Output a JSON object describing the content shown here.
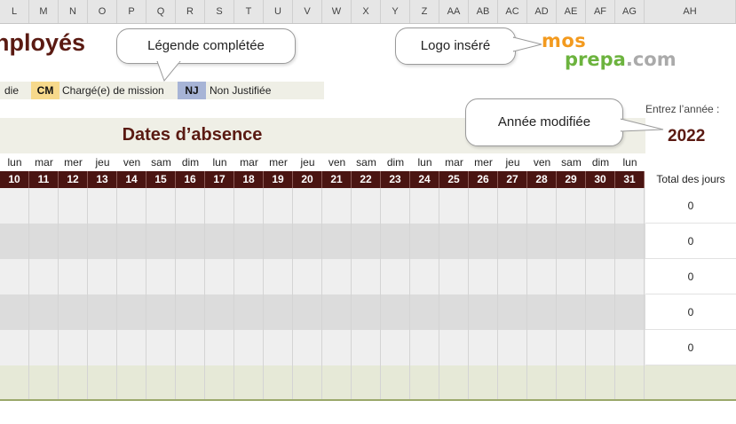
{
  "column_headers": [
    "L",
    "M",
    "N",
    "O",
    "P",
    "Q",
    "R",
    "S",
    "T",
    "U",
    "V",
    "W",
    "X",
    "Y",
    "Z",
    "AA",
    "AB",
    "AC",
    "AD",
    "AE",
    "AF",
    "AG",
    "AH"
  ],
  "title": "nployés",
  "legend": {
    "item1_text": "die",
    "cm_code": "CM",
    "cm_text": "Chargé(e) de mission",
    "nj_code": "NJ",
    "nj_text": "Non Justifiée",
    "cm_color": "#f7d98b",
    "nj_color": "#a7b4d6"
  },
  "callouts": {
    "legend": "Légende complétée",
    "logo": "Logo inséré",
    "year": "Année modifiée"
  },
  "logo": {
    "line1": "mos",
    "line2": "prepa",
    "suffix": ".com"
  },
  "year": {
    "label": "Entrez l’année :",
    "value": "2022"
  },
  "dates_title": "Dates d’absence",
  "day_names": [
    "lun",
    "mar",
    "mer",
    "jeu",
    "ven",
    "sam",
    "dim",
    "lun",
    "mar",
    "mer",
    "jeu",
    "ven",
    "sam",
    "dim",
    "lun",
    "mar",
    "mer",
    "jeu",
    "ven",
    "sam",
    "dim",
    "lun"
  ],
  "day_numbers": [
    "10",
    "11",
    "12",
    "13",
    "14",
    "15",
    "16",
    "17",
    "18",
    "19",
    "20",
    "21",
    "22",
    "23",
    "24",
    "25",
    "26",
    "27",
    "28",
    "29",
    "30",
    "31"
  ],
  "total_header": "Total des jours",
  "totals": [
    "0",
    "0",
    "0",
    "0",
    "0"
  ],
  "colors": {
    "accent": "#5a1a12",
    "header_bg": "#4a1512",
    "band": "#efefe6",
    "row_alt": "#dcdcdc",
    "row": "#efefef"
  }
}
